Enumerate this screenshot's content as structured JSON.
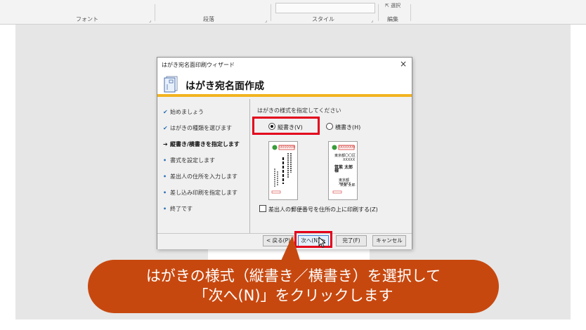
{
  "ribbon": {
    "groups": [
      "フォント",
      "段落",
      "スタイル",
      "編集"
    ],
    "select_label": "選択"
  },
  "dialog": {
    "title": "はがき宛名面印刷ウィザード",
    "close_glyph": "×",
    "heading": "はがき宛名面作成",
    "steps": [
      {
        "label": "始めましょう",
        "state": "done",
        "marker": "✔"
      },
      {
        "label": "はがきの種類を選びます",
        "state": "done",
        "marker": "✔"
      },
      {
        "label": "縦書き/横書きを指定します",
        "state": "current",
        "marker": "➔"
      },
      {
        "label": "書式を設定します",
        "state": "todo",
        "marker": "•"
      },
      {
        "label": "差出人の住所を入力します",
        "state": "todo",
        "marker": "•"
      },
      {
        "label": "差し込み印刷を指定します",
        "state": "todo",
        "marker": "•"
      },
      {
        "label": "終了です",
        "state": "todo",
        "marker": "•"
      }
    ],
    "prompt": "はがきの様式を指定してください",
    "radio_vertical": "縦書き(V)",
    "radio_horizontal": "横書き(H)",
    "selected": "vertical",
    "preview_vertical": {
      "postal": "0000000",
      "name": "筑 紫 太 郎 様"
    },
    "preview_horizontal": {
      "postal": "0000000",
      "address1": "東京都〇〇区",
      "address2": "XXXXX",
      "name": "筑紫 太郎 様",
      "sender1": "東京都XXXXX",
      "sender2": "筑紫 太郎"
    },
    "checkbox_label": "差出人の郵便番号を住所の上に印刷する(Z)",
    "buttons": {
      "back": "< 戻る(P)",
      "next": "次へ(N) >",
      "finish": "完了(F)",
      "cancel": "キャンセル"
    }
  },
  "callout": {
    "line1": "はがきの様式（縦書き／横書き）を選択して",
    "line2": "「次へ(N)」をクリックします"
  },
  "colors": {
    "accent": "#f2b320",
    "highlight": "#e3001b",
    "callout": "#c7480f",
    "check": "#2a6fb6"
  }
}
